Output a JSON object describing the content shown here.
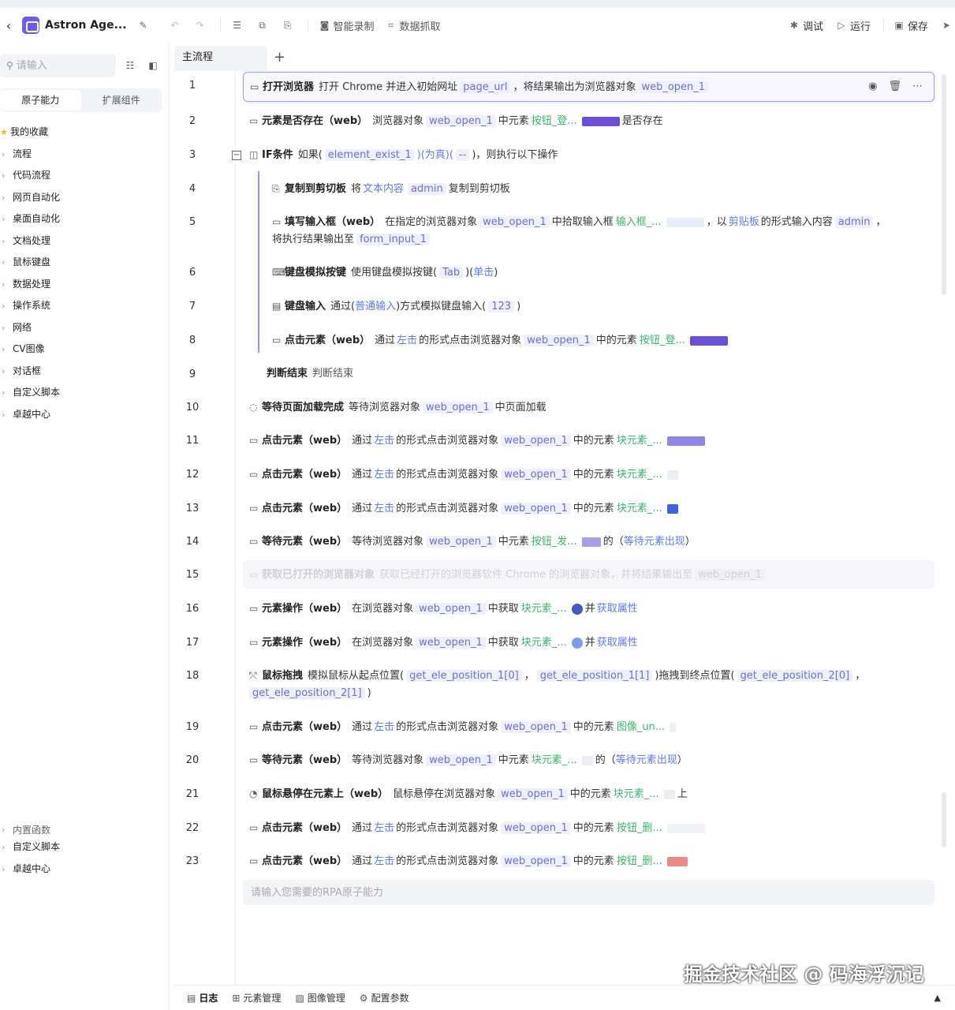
{
  "toolbar": {
    "title": "Astron Age...",
    "record": "智能录制",
    "capture": "数据抓取",
    "debug": "调试",
    "run": "运行",
    "save": "保存"
  },
  "sidebar": {
    "search_placeholder": "请输入",
    "tabs": [
      "原子能力",
      "扩展组件"
    ],
    "items": [
      "我的收藏",
      "流程",
      "代码流程",
      "网页自动化",
      "桌面自动化",
      "文档处理",
      "鼠标键盘",
      "数据处理",
      "操作系统",
      "网络",
      "CV图像",
      "对话框",
      "自定义脚本",
      "卓越中心"
    ],
    "items2": [
      "内置函数",
      "自定义脚本",
      "卓越中心"
    ]
  },
  "main": {
    "flow_tab": "主流程",
    "add": "+",
    "prompt_placeholder": "请输入您需要的RPA原子能力"
  },
  "rows": {
    "r1": {
      "num": "1",
      "title": "打开浏览器",
      "t1": "打开 Chrome 并进入初始网址",
      "v1": "page_url",
      "t2": "，将结果输出为浏览器对象",
      "v2": "web_open_1"
    },
    "r2": {
      "num": "2",
      "title": "元素是否存在（web）",
      "t1": "浏览器对象",
      "v1": "web_open_1",
      "t2": "中元素",
      "g1": "按钮_登...",
      "t3": "是否存在"
    },
    "r3": {
      "num": "3",
      "title": "IF条件",
      "t1": "如果(",
      "v1": "element_exist_1",
      "t2": ")(为真)(",
      "v2": "--",
      "t3": ")，则执行以下操作"
    },
    "r4": {
      "num": "4",
      "title": "复制到剪切板",
      "t1": "将",
      "b1": "文本内容",
      "v1": "admin",
      "t2": "复制到剪切板"
    },
    "r5": {
      "num": "5",
      "title": "填写输入框（web）",
      "t1": "在指定的浏览器对象",
      "v1": "web_open_1",
      "t2": "中拾取输入框",
      "g1": "输入框_...",
      "t3": "，以",
      "b1": "剪贴板",
      "t4": "的形式输入内容",
      "v2": "admin",
      "t5": "，",
      "t6": "将执行结果输出至",
      "v3": "form_input_1"
    },
    "r6": {
      "num": "6",
      "title": "键盘模拟按键",
      "t1": "使用键盘模拟按键(",
      "v1": "Tab",
      "t2": ")(",
      "b1": "单击",
      "t3": ")"
    },
    "r7": {
      "num": "7",
      "title": "键盘输入",
      "t1": "通过(",
      "b1": "普通输入",
      "t2": ")方式模拟键盘输入(",
      "v1": "123",
      "t3": ")"
    },
    "r8": {
      "num": "8",
      "title": "点击元素（web）",
      "t1": "通过",
      "b1": "左击",
      "t2": "的形式点击浏览器对象",
      "v1": "web_open_1",
      "t3": "中的元素",
      "g1": "按钮_登..."
    },
    "r9": {
      "num": "9",
      "title": "判断结束",
      "t1": "判断结束"
    },
    "r10": {
      "num": "10",
      "title": "等待页面加载完成",
      "t1": "等待浏览器对象",
      "v1": "web_open_1",
      "t2": "中页面加载"
    },
    "r11": {
      "num": "11",
      "title": "点击元素（web）",
      "t1": "通过",
      "b1": "左击",
      "t2": "的形式点击浏览器对象",
      "v1": "web_open_1",
      "t3": "中的元素",
      "g1": "块元素_..."
    },
    "r12": {
      "num": "12",
      "title": "点击元素（web）",
      "t1": "通过",
      "b1": "左击",
      "t2": "的形式点击浏览器对象",
      "v1": "web_open_1",
      "t3": "中的元素",
      "g1": "块元素_..."
    },
    "r13": {
      "num": "13",
      "title": "点击元素（web）",
      "t1": "通过",
      "b1": "左击",
      "t2": "的形式点击浏览器对象",
      "v1": "web_open_1",
      "t3": "中的元素",
      "g1": "块元素_..."
    },
    "r14": {
      "num": "14",
      "title": "等待元素（web）",
      "t1": "等待浏览器对象",
      "v1": "web_open_1",
      "t2": "中元素",
      "g1": "按钮_发...",
      "t3": "的（",
      "b1": "等待元素出现",
      "t4": "）"
    },
    "r15": {
      "num": "15",
      "title": "获取已打开的浏览器对象",
      "t1": "获取已经打开的浏览器软件 Chrome 的浏览器对象，并将结果输出至",
      "v1": "web_open_1"
    },
    "r16": {
      "num": "16",
      "title": "元素操作（web）",
      "t1": "在浏览器对象",
      "v1": "web_open_1",
      "t2": "中获取",
      "g1": "块元素_...",
      "t3": "并",
      "b1": "获取属性"
    },
    "r17": {
      "num": "17",
      "title": "元素操作（web）",
      "t1": "在浏览器对象",
      "v1": "web_open_1",
      "t2": "中获取",
      "g1": "块元素_...",
      "t3": "并",
      "b1": "获取属性"
    },
    "r18": {
      "num": "18",
      "title": "鼠标拖拽",
      "t1": "模拟鼠标从起点位置(",
      "v1": "get_ele_position_1[0]",
      "t2": "，",
      "v2": "get_ele_position_1[1]",
      "t3": ")拖拽到终点位置(",
      "v3": "get_ele_position_2[0]",
      "t4": "，",
      "v4": "get_ele_position_2[1]",
      "t5": ")"
    },
    "r19": {
      "num": "19",
      "title": "点击元素（web）",
      "t1": "通过",
      "b1": "左击",
      "t2": "的形式点击浏览器对象",
      "v1": "web_open_1",
      "t3": "中的元素",
      "g1": "图像_un..."
    },
    "r20": {
      "num": "20",
      "title": "等待元素（web）",
      "t1": "等待浏览器对象",
      "v1": "web_open_1",
      "t2": "中元素",
      "g1": "块元素_...",
      "t3": "的（",
      "b1": "等待元素出现",
      "t4": "）"
    },
    "r21": {
      "num": "21",
      "title": "鼠标悬停在元素上（web）",
      "t1": "鼠标悬停在浏览器对象",
      "v1": "web_open_1",
      "t2": "中的元素",
      "g1": "块元素_...",
      "t3": "上"
    },
    "r22": {
      "num": "22",
      "title": "点击元素（web）",
      "t1": "通过",
      "b1": "左击",
      "t2": "的形式点击浏览器对象",
      "v1": "web_open_1",
      "t3": "中的元素",
      "g1": "按钮_删..."
    },
    "r23": {
      "num": "23",
      "title": "点击元素（web）",
      "t1": "通过",
      "b1": "左击",
      "t2": "的形式点击浏览器对象",
      "v1": "web_open_1",
      "t3": "中的元素",
      "g1": "按钮_删..."
    }
  },
  "bottom": {
    "log": "日志",
    "elements": "元素管理",
    "images": "图像管理",
    "config": "配置参数"
  },
  "watermark": "掘金技术社区 @ 码海浮沉记",
  "colors": {
    "accent": "#6b6fd8",
    "green": "#3bb56c",
    "blue": "#5b7cf0"
  }
}
